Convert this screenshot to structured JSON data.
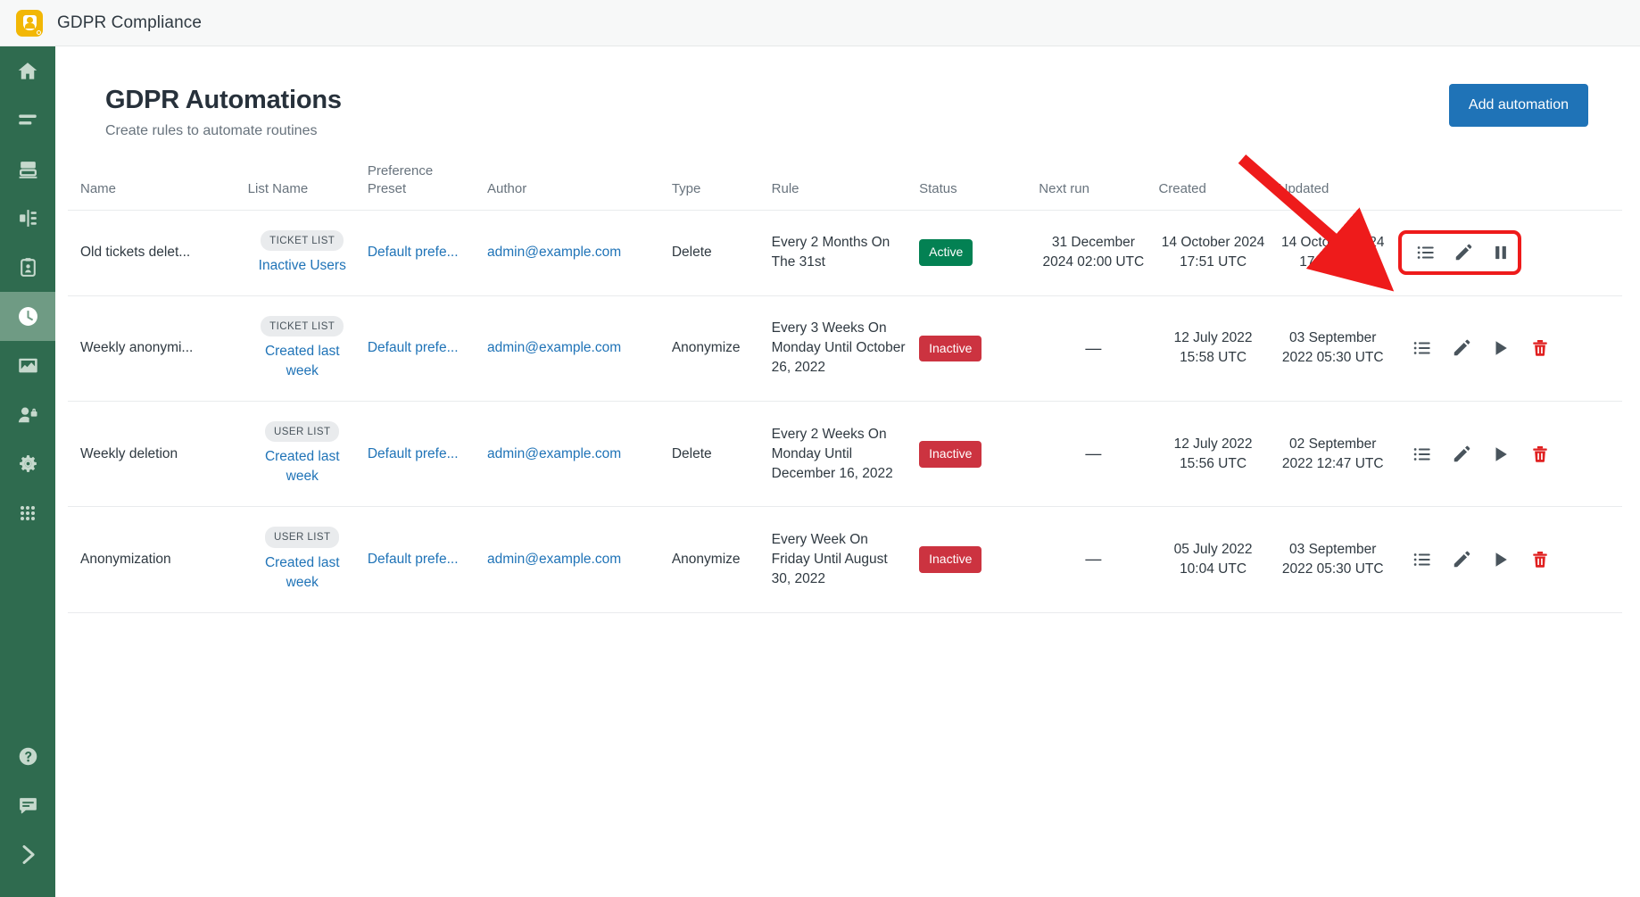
{
  "app": {
    "title": "GDPR Compliance",
    "logo_icon": "shield-person-icon"
  },
  "sidebar": {
    "items": [
      {
        "icon": "home-icon",
        "name": "home",
        "active": false
      },
      {
        "icon": "lines-icon",
        "name": "views",
        "active": false
      },
      {
        "icon": "database-icon",
        "name": "data",
        "active": false
      },
      {
        "icon": "flow-icon",
        "name": "workflows",
        "active": false
      },
      {
        "icon": "clipboard-person-icon",
        "name": "records",
        "active": false
      },
      {
        "icon": "clock-icon",
        "name": "automations",
        "active": true
      },
      {
        "icon": "chart-icon",
        "name": "reports",
        "active": false
      },
      {
        "icon": "user-lock-icon",
        "name": "privacy",
        "active": false
      },
      {
        "icon": "gear-icon",
        "name": "settings",
        "active": false
      },
      {
        "icon": "grid-apps-icon",
        "name": "apps",
        "active": false
      }
    ],
    "bottom_items": [
      {
        "icon": "help-circle-icon",
        "name": "help"
      },
      {
        "icon": "chat-icon",
        "name": "messages"
      },
      {
        "icon": "chevron-right-icon",
        "name": "expand-sidebar"
      }
    ]
  },
  "page": {
    "title": "GDPR Automations",
    "subtitle": "Create rules to automate routines",
    "add_button": "Add automation"
  },
  "table": {
    "headers": {
      "name": "Name",
      "list_name": "List Name",
      "preference_preset_line1": "Preference",
      "preference_preset_line2": "Preset",
      "author": "Author",
      "type": "Type",
      "rule": "Rule",
      "status": "Status",
      "next_run": "Next run",
      "created": "Created",
      "updated": "Updated"
    },
    "rows": [
      {
        "name": "Old tickets delet...",
        "list_tag": "TICKET LIST",
        "list_name": "Inactive Users",
        "preset": "Default prefe...",
        "author": "admin@example.com",
        "type": "Delete",
        "rule": "Every 2 Months On The 31st",
        "status": "Active",
        "status_kind": "active",
        "next_run": "31 December 2024 02:00 UTC",
        "created": "14 October 2024 17:51 UTC",
        "updated": "14 October 2024 17:52 UTC",
        "actions": [
          "list-icon",
          "pencil-icon",
          "pause-icon"
        ],
        "highlighted": true
      },
      {
        "name": "Weekly anonymi...",
        "list_tag": "TICKET LIST",
        "list_name": "Created last week",
        "preset": "Default prefe...",
        "author": "admin@example.com",
        "type": "Anonymize",
        "rule": "Every 3 Weeks On Monday Until October 26, 2022",
        "status": "Inactive",
        "status_kind": "inactive",
        "next_run": "—",
        "created": "12 July 2022 15:58 UTC",
        "updated": "03 September 2022 05:30 UTC",
        "actions": [
          "list-icon",
          "pencil-icon",
          "play-icon",
          "trash-icon"
        ],
        "highlighted": false
      },
      {
        "name": "Weekly deletion",
        "list_tag": "USER LIST",
        "list_name": "Created last week",
        "preset": "Default prefe...",
        "author": "admin@example.com",
        "type": "Delete",
        "rule": "Every 2 Weeks On Monday Until December 16, 2022",
        "status": "Inactive",
        "status_kind": "inactive",
        "next_run": "—",
        "created": "12 July 2022 15:56 UTC",
        "updated": "02 September 2022 12:47 UTC",
        "actions": [
          "list-icon",
          "pencil-icon",
          "play-icon",
          "trash-icon"
        ],
        "highlighted": false
      },
      {
        "name": "Anonymization",
        "list_tag": "USER LIST",
        "list_name": "Created last week",
        "preset": "Default prefe...",
        "author": "admin@example.com",
        "type": "Anonymize",
        "rule": "Every Week On Friday Until August 30, 2022",
        "status": "Inactive",
        "status_kind": "inactive",
        "next_run": "—",
        "created": "05 July 2022 10:04 UTC",
        "updated": "03 September 2022 05:30 UTC",
        "actions": [
          "list-icon",
          "pencil-icon",
          "play-icon",
          "trash-icon"
        ],
        "highlighted": false
      }
    ]
  },
  "annotation": {
    "arrow_color": "#ee1b1b",
    "highlight_color": "#ee1b1b",
    "target": "pause-icon"
  },
  "colors": {
    "sidebar_bg": "#2f6b4f",
    "sidebar_active": "#6f9b84",
    "primary_button": "#1f73b7",
    "link": "#1f73b7",
    "status_active": "#038153",
    "status_inactive": "#cc3340",
    "logo_yellow": "#f2b705"
  }
}
